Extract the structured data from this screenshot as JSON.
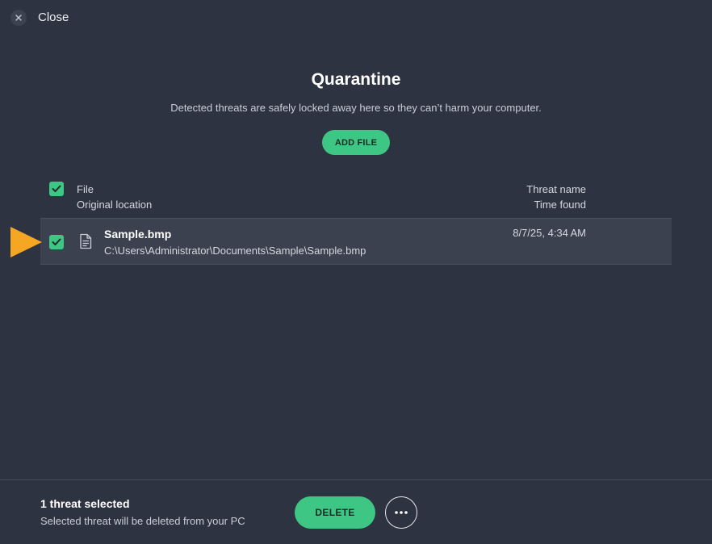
{
  "window": {
    "close_label": "Close"
  },
  "header": {
    "title": "Quarantine",
    "subtitle": "Detected threats are safely locked away here so they can’t harm your computer.",
    "add_file_label": "ADD FILE"
  },
  "table": {
    "columns": {
      "file": "File",
      "original_location": "Original location",
      "threat_name": "Threat name",
      "time_found": "Time found"
    },
    "select_all_checked": true,
    "rows": [
      {
        "checked": true,
        "file_name": "Sample.bmp",
        "location": "C:\\Users\\Administrator\\Documents\\Sample\\Sample.bmp",
        "time_found": "8/7/25, 4:34 AM",
        "icon": "document-icon"
      }
    ]
  },
  "footer": {
    "selected_count": "1 threat selected",
    "selected_desc": "Selected threat will be deleted from your PC",
    "delete_label": "DELETE",
    "more_icon": "more-options-icon"
  },
  "colors": {
    "background": "#2d3340",
    "accent": "#3ec784",
    "row_highlight": "#3b414e",
    "pointer_arrow": "#f5a623"
  }
}
